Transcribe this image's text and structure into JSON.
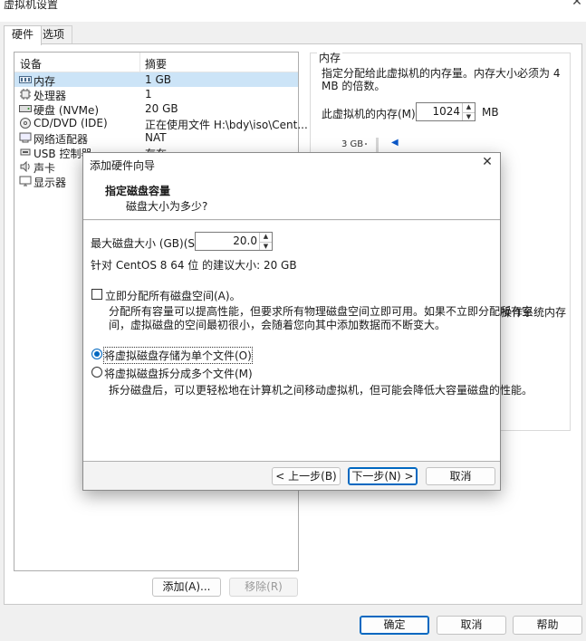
{
  "window": {
    "title": "虚拟机设置",
    "close_icon": "✕"
  },
  "tabs": [
    "硬件",
    "选项"
  ],
  "device_list": {
    "headers": [
      "设备",
      "摘要"
    ],
    "rows": [
      {
        "name": "内存",
        "summary": "1 GB",
        "icon": "memory-icon"
      },
      {
        "name": "处理器",
        "summary": "1",
        "icon": "cpu-icon"
      },
      {
        "name": "硬盘 (NVMe)",
        "summary": "20 GB",
        "icon": "disk-icon"
      },
      {
        "name": "CD/DVD (IDE)",
        "summary": "正在使用文件 H:\\bdy\\iso\\Cent...",
        "icon": "cdrom-icon"
      },
      {
        "name": "网络适配器",
        "summary": "NAT",
        "icon": "network-icon"
      },
      {
        "name": "USB 控制器",
        "summary": "存在",
        "icon": "usb-icon"
      },
      {
        "name": "声卡",
        "summary": "",
        "icon": "sound-icon"
      },
      {
        "name": "显示器",
        "summary": "",
        "icon": "display-icon"
      }
    ],
    "add_button": "添加(A)...",
    "remove_button": "移除(R)"
  },
  "memory_panel": {
    "title": "内存",
    "description": "指定分配给此虚拟机的内存量。内存大小必须为 4 MB 的倍数。",
    "label": "此虚拟机的内存(M):",
    "value": "1024",
    "unit": "MB",
    "scale_top": "3 GB",
    "background_text": "操作系统内存"
  },
  "bottom_buttons": {
    "ok": "确定",
    "cancel": "取消",
    "help": "帮助"
  },
  "dialog": {
    "title": "添加硬件向导",
    "header_title": "指定磁盘容量",
    "header_subtitle": "磁盘大小为多少?",
    "max_size_label": "最大磁盘大小 (GB)(S):",
    "max_size_value": "20.0",
    "recommended": "针对 CentOS 8 64 位 的建议大小: 20 GB",
    "allocate_all_label": "立即分配所有磁盘空间(A)。",
    "allocate_all_checked": false,
    "allocate_desc_line1": "分配所有容量可以提高性能，但要求所有物理磁盘空间立即可用。如果不立即分配所有空",
    "allocate_desc_line2": "间，虚拟磁盘的空间最初很小，会随着您向其中添加数据而不断变大。",
    "single_file_label": "将虚拟磁盘存储为单个文件(O)",
    "split_file_label": "将虚拟磁盘拆分成多个文件(M)",
    "selected_option": "single_file",
    "split_desc": "拆分磁盘后，可以更轻松地在计算机之间移动虚拟机，但可能会降低大容量磁盘的性能。",
    "back_button": "< 上一步(B)",
    "next_button": "下一步(N) >",
    "cancel_button": "取消"
  }
}
